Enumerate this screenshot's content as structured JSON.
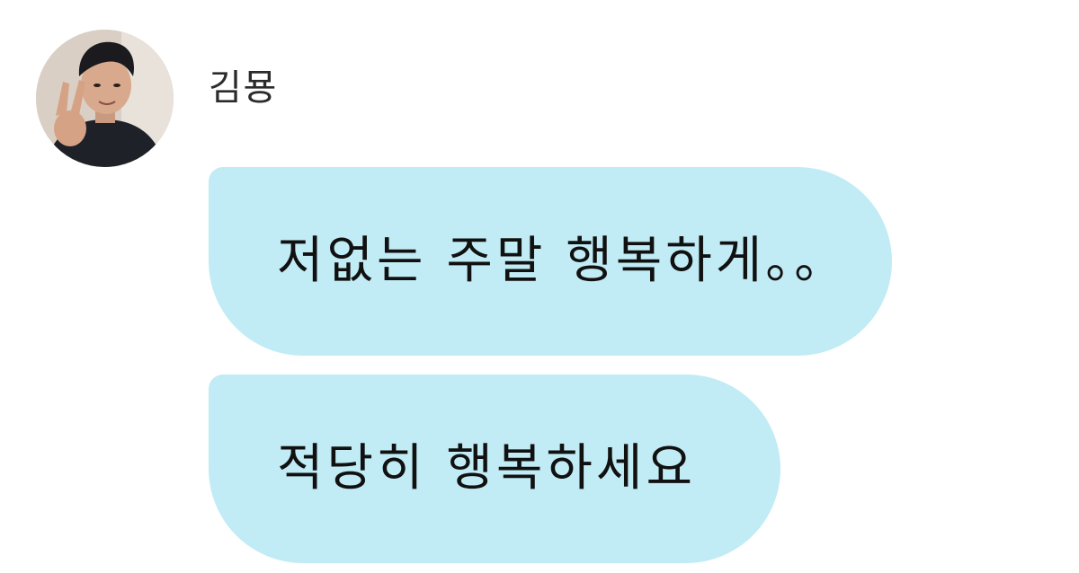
{
  "sender": {
    "name": "김묭"
  },
  "messages": [
    {
      "text": "저없는 주말 행복하게。。"
    },
    {
      "text": "적당히 행복하세요"
    }
  ],
  "colors": {
    "bubble": "#c1ecf5",
    "name_text": "#2b2b2b",
    "message_text": "#111111",
    "background": "#ffffff"
  }
}
